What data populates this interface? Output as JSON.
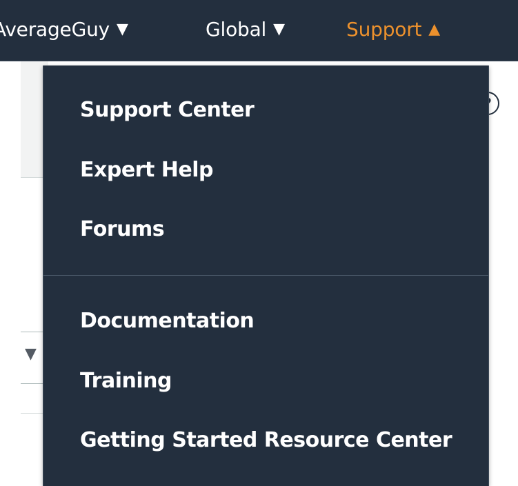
{
  "topbar": {
    "account_label": "AverageGuy",
    "account_caret": "▼",
    "region_label": "Global",
    "region_caret": "▼",
    "support_label": "Support",
    "support_caret": "▲"
  },
  "page": {
    "help_icon_glyph": "?",
    "select_caret": "▼"
  },
  "support_menu": {
    "group_1": [
      "Support Center",
      "Expert Help",
      "Forums"
    ],
    "group_2": [
      "Documentation",
      "Training",
      "Getting Started Resource Center"
    ]
  },
  "colors": {
    "nav_background": "#232f3e",
    "active_accent": "#ec912d",
    "menu_text": "#ffffff"
  }
}
